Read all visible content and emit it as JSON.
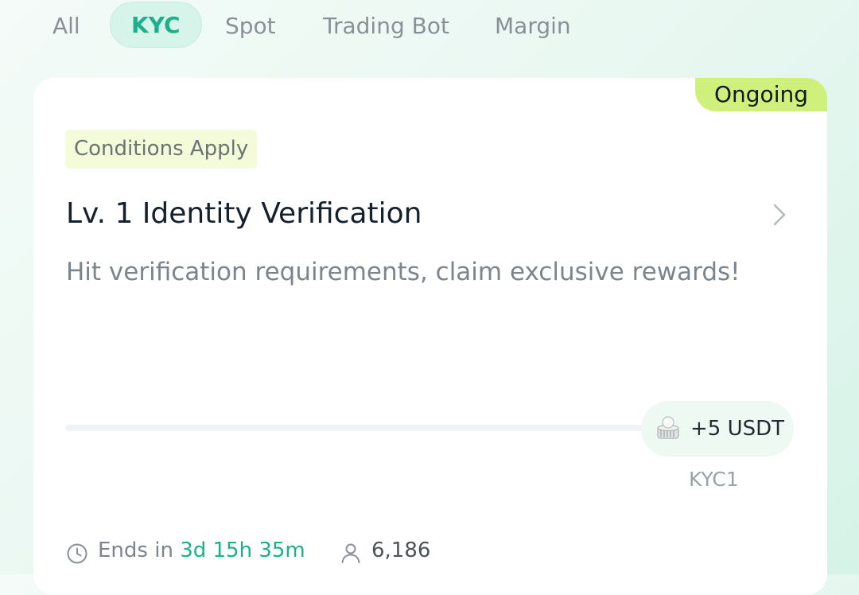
{
  "tabs": [
    {
      "label": "All"
    },
    {
      "label": "KYC",
      "active": true
    },
    {
      "label": "Spot"
    },
    {
      "label": "Trading Bot"
    },
    {
      "label": "Margin"
    }
  ],
  "card": {
    "status": "Ongoing",
    "tag": "Conditions Apply",
    "title": "Lv. 1 Identity Verification",
    "description": "Hit verification requirements, claim exclusive rewards!",
    "progress": 0,
    "reward": {
      "icon": "coin-stack-icon",
      "amount": "+5 USDT"
    },
    "milestone": "KYC1",
    "ends_label": "Ends in",
    "ends_value": "3d 15h 35m",
    "participants": "6,186"
  },
  "colors": {
    "accent": "#1db08a",
    "status_bg": "#cff07a",
    "tag_bg": "#f3fbd8",
    "text_primary": "#14202b",
    "text_secondary": "#7c858c"
  }
}
